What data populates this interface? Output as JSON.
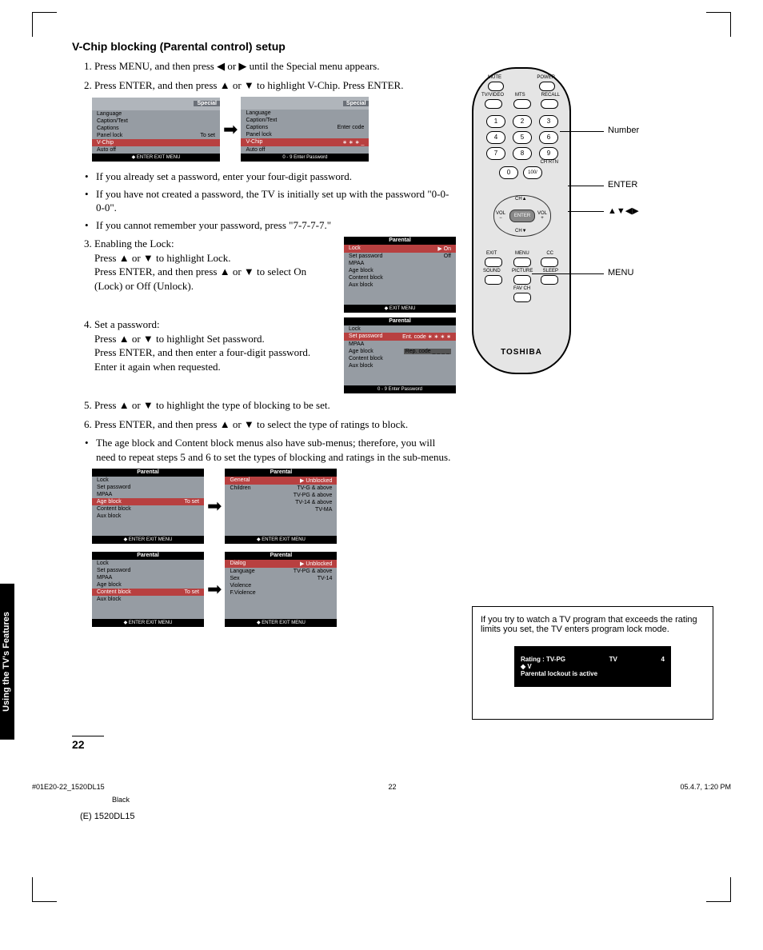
{
  "title": "V-Chip blocking (Parental control) setup",
  "steps": {
    "s1": "Press MENU, and then press ◀ or ▶ until the Special menu appears.",
    "s2": "Press ENTER, and then press ▲ or ▼ to highlight V-Chip. Press ENTER.",
    "b1": "If you already set a password, enter your four-digit password.",
    "b2": "If you have not created a password, the TV is initially set up with the password \"0-0-0-0\".",
    "b3": "If you cannot remember your password, press \"7-7-7-7.\"",
    "s3a": "Enabling the Lock:",
    "s3b": "Press ▲ or ▼ to highlight Lock.",
    "s3c": "Press ENTER, and then press ▲ or ▼ to select On (Lock) or Off (Unlock).",
    "s4a": "Set a password:",
    "s4b": "Press ▲ or ▼ to highlight Set password.",
    "s4c": "Press ENTER, and then enter a four-digit password.",
    "s4d": "Enter it again when requested.",
    "s5": "Press ▲ or ▼ to highlight the type of blocking to be set.",
    "s6": "Press ENTER, and then press ▲ or ▼ to select the type of ratings to block.",
    "b4": "The age block and Content block menus also have sub-menus; therefore, you will need to repeat steps 5 and 6 to set the types of blocking and ratings in the sub-menus."
  },
  "menu1": {
    "tab": "Special",
    "rows": [
      [
        "Language",
        ""
      ],
      [
        "Caption/Text",
        ""
      ],
      [
        "Captions",
        ""
      ],
      [
        "Panel lock",
        "To set"
      ],
      [
        "V-Chip",
        ""
      ],
      [
        "Auto off",
        ""
      ]
    ],
    "foot": "◆ ENTER EXIT MENU"
  },
  "menu2": {
    "tab": "Special",
    "rows": [
      [
        "Language",
        ""
      ],
      [
        "Caption/Text",
        ""
      ],
      [
        "Captions",
        "Enter code"
      ],
      [
        "Panel lock",
        ""
      ],
      [
        "V-Chip",
        "∗  ∗  ∗  _"
      ],
      [
        "Auto off",
        ""
      ]
    ],
    "foot": "0 - 9 Enter Password"
  },
  "menu3": {
    "title": "Parental",
    "rows": [
      [
        "Lock",
        "▶ On"
      ],
      [
        "Set password",
        "Off"
      ],
      [
        "MPAA",
        ""
      ],
      [
        "Age block",
        ""
      ],
      [
        "Content block",
        ""
      ],
      [
        "Aux block",
        ""
      ]
    ],
    "foot": "◆ EXIT MENU"
  },
  "menu4": {
    "title": "Parental",
    "rows": [
      [
        "Lock",
        ""
      ],
      [
        "Set password",
        "Ent. code    ∗ ∗ ∗ ∗"
      ],
      [
        "MPAA",
        ""
      ],
      [
        "Age block",
        "Rep. code    _ _ _ _"
      ],
      [
        "Content block",
        ""
      ],
      [
        "Aux block",
        ""
      ]
    ],
    "foot": "0 - 9 Enter Password"
  },
  "menu5": {
    "title": "Parental",
    "rows": [
      [
        "Lock",
        ""
      ],
      [
        "Set password",
        ""
      ],
      [
        "MPAA",
        ""
      ],
      [
        "Age block",
        "To set"
      ],
      [
        "Content block",
        ""
      ],
      [
        "Aux block",
        ""
      ]
    ],
    "foot": "◆ ENTER EXIT MENU"
  },
  "menu6": {
    "title": "Parental",
    "rows": [
      [
        "General",
        "▶ Unblocked"
      ],
      [
        "Children",
        "TV-G & above"
      ],
      [
        "",
        "TV-PG & above"
      ],
      [
        "",
        "TV-14 & above"
      ],
      [
        "",
        "TV-MA"
      ]
    ],
    "foot": "◆ ENTER EXIT MENU"
  },
  "menu7": {
    "title": "Parental",
    "rows": [
      [
        "Lock",
        ""
      ],
      [
        "Set password",
        ""
      ],
      [
        "MPAA",
        ""
      ],
      [
        "Age block",
        ""
      ],
      [
        "Content block",
        "To set"
      ],
      [
        "Aux block",
        ""
      ]
    ],
    "foot": "◆ ENTER EXIT MENU"
  },
  "menu8": {
    "title": "Parental",
    "rows": [
      [
        "Dialog",
        "▶ Unblocked"
      ],
      [
        "Language",
        "TV-PG & above"
      ],
      [
        "Sex",
        "TV-14"
      ],
      [
        "Violence",
        ""
      ],
      [
        "F.Violence",
        ""
      ]
    ],
    "foot": "◆ ENTER EXIT MENU"
  },
  "remote": {
    "labels": {
      "mute": "MUTE",
      "power": "POWER",
      "tvvideo": "TV/VIDEO",
      "mts": "MTS",
      "recall": "RECALL",
      "chrtn": "CH RTN",
      "exit": "EXIT",
      "menu": "MENU",
      "cc": "CC",
      "sound": "SOUND",
      "picture": "PICTURE",
      "sleep": "SLEEP",
      "favch": "FAV CH"
    },
    "enter": "ENTER",
    "brand": "TOSHIBA",
    "callouts": {
      "number": "Number",
      "enter": "ENTER",
      "arrows": "▲▼◀▶",
      "menu": "MENU"
    }
  },
  "warn": {
    "text": "If you try to watch a TV program that exceeds the rating limits you set, the TV enters program lock mode.",
    "r1a": "Rating : TV-PG",
    "r1b": "TV",
    "r1c": "4",
    "r2": "◆            V",
    "r3": "Parental lockout is active"
  },
  "sidetab": "Using the TV's Features",
  "pagenum": "22",
  "footer": {
    "a": "#01E20-22_1520DL15",
    "b": "22",
    "c": "05.4.7, 1:20 PM",
    "d": "Black",
    "model": "(E) 1520DL15"
  }
}
